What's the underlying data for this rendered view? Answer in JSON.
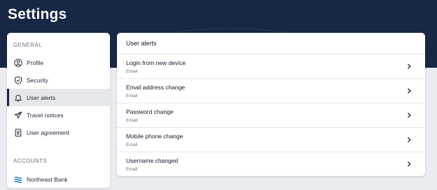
{
  "header": {
    "title": "Settings"
  },
  "sidebar": {
    "general_label": "GENERAL",
    "items": [
      {
        "label": "Profile",
        "icon": "person-circle-icon"
      },
      {
        "label": "Security",
        "icon": "shield-icon"
      },
      {
        "label": "User alerts",
        "icon": "bell-icon",
        "active": true
      },
      {
        "label": "Travel notices",
        "icon": "airplane-icon"
      },
      {
        "label": "User agreement",
        "icon": "document-icon"
      }
    ],
    "accounts_label": "ACCOUNTS",
    "accounts": [
      {
        "label": "Northeast Bank",
        "icon": "bank-logo-icon"
      }
    ]
  },
  "main": {
    "title": "User alerts",
    "alerts": [
      {
        "name": "Login from new device",
        "channel": "Email"
      },
      {
        "name": "Email address change",
        "channel": "Email"
      },
      {
        "name": "Password change",
        "channel": "Email"
      },
      {
        "name": "Mobile phone change",
        "channel": "Email"
      },
      {
        "name": "Username changed",
        "channel": "Email"
      }
    ]
  },
  "colors": {
    "header_bg": "#172744",
    "page_bg": "#e9ecf1",
    "active_item_bg": "#e5e7eb",
    "bank_logo": "#1a73c8"
  }
}
